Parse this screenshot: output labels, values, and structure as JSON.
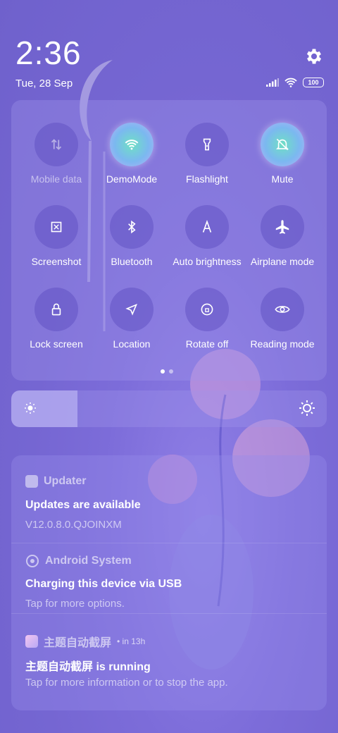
{
  "status": {
    "time": "2:36",
    "date": "Tue, 28 Sep",
    "battery": "100"
  },
  "quick_settings": {
    "tiles": [
      {
        "label": "Mobile data",
        "icon": "mobile-data-icon",
        "state": "disabled"
      },
      {
        "label": "DemoMode",
        "icon": "wifi-icon",
        "state": "on"
      },
      {
        "label": "Flashlight",
        "icon": "flashlight-icon",
        "state": "off"
      },
      {
        "label": "Mute",
        "icon": "mute-bell-icon",
        "state": "on"
      },
      {
        "label": "Screenshot",
        "icon": "screenshot-icon",
        "state": "off"
      },
      {
        "label": "Bluetooth",
        "icon": "bluetooth-icon",
        "state": "off"
      },
      {
        "label": "Auto brightness",
        "icon": "auto-brightness-icon",
        "state": "off"
      },
      {
        "label": "Airplane mode",
        "icon": "airplane-icon",
        "state": "off"
      },
      {
        "label": "Lock screen",
        "icon": "lock-icon",
        "state": "off"
      },
      {
        "label": "Location",
        "icon": "location-icon",
        "state": "off"
      },
      {
        "label": "Rotate off",
        "icon": "rotate-lock-icon",
        "state": "off"
      },
      {
        "label": "Reading mode",
        "icon": "eye-icon",
        "state": "off"
      }
    ],
    "page_count": 2,
    "current_page": 1,
    "brightness_level": 0.21
  },
  "notifications": [
    {
      "app": "Updater",
      "time": "",
      "title": "Updates are available",
      "text": "V12.0.8.0.QJOINXM",
      "icon": "updater-icon"
    },
    {
      "app": "Android System",
      "time": "",
      "title": "Charging this device via USB",
      "text": "Tap for more options.",
      "icon": "android-system-icon"
    },
    {
      "app": "主题自动截屏",
      "time": "• in 13h",
      "title": "主题自动截屏 is running",
      "text": "Tap for more information or to stop the app.",
      "icon": "theme-app-icon"
    }
  ],
  "colors": {
    "accent_active": "#6fe0c4",
    "background": "#7566d2"
  }
}
